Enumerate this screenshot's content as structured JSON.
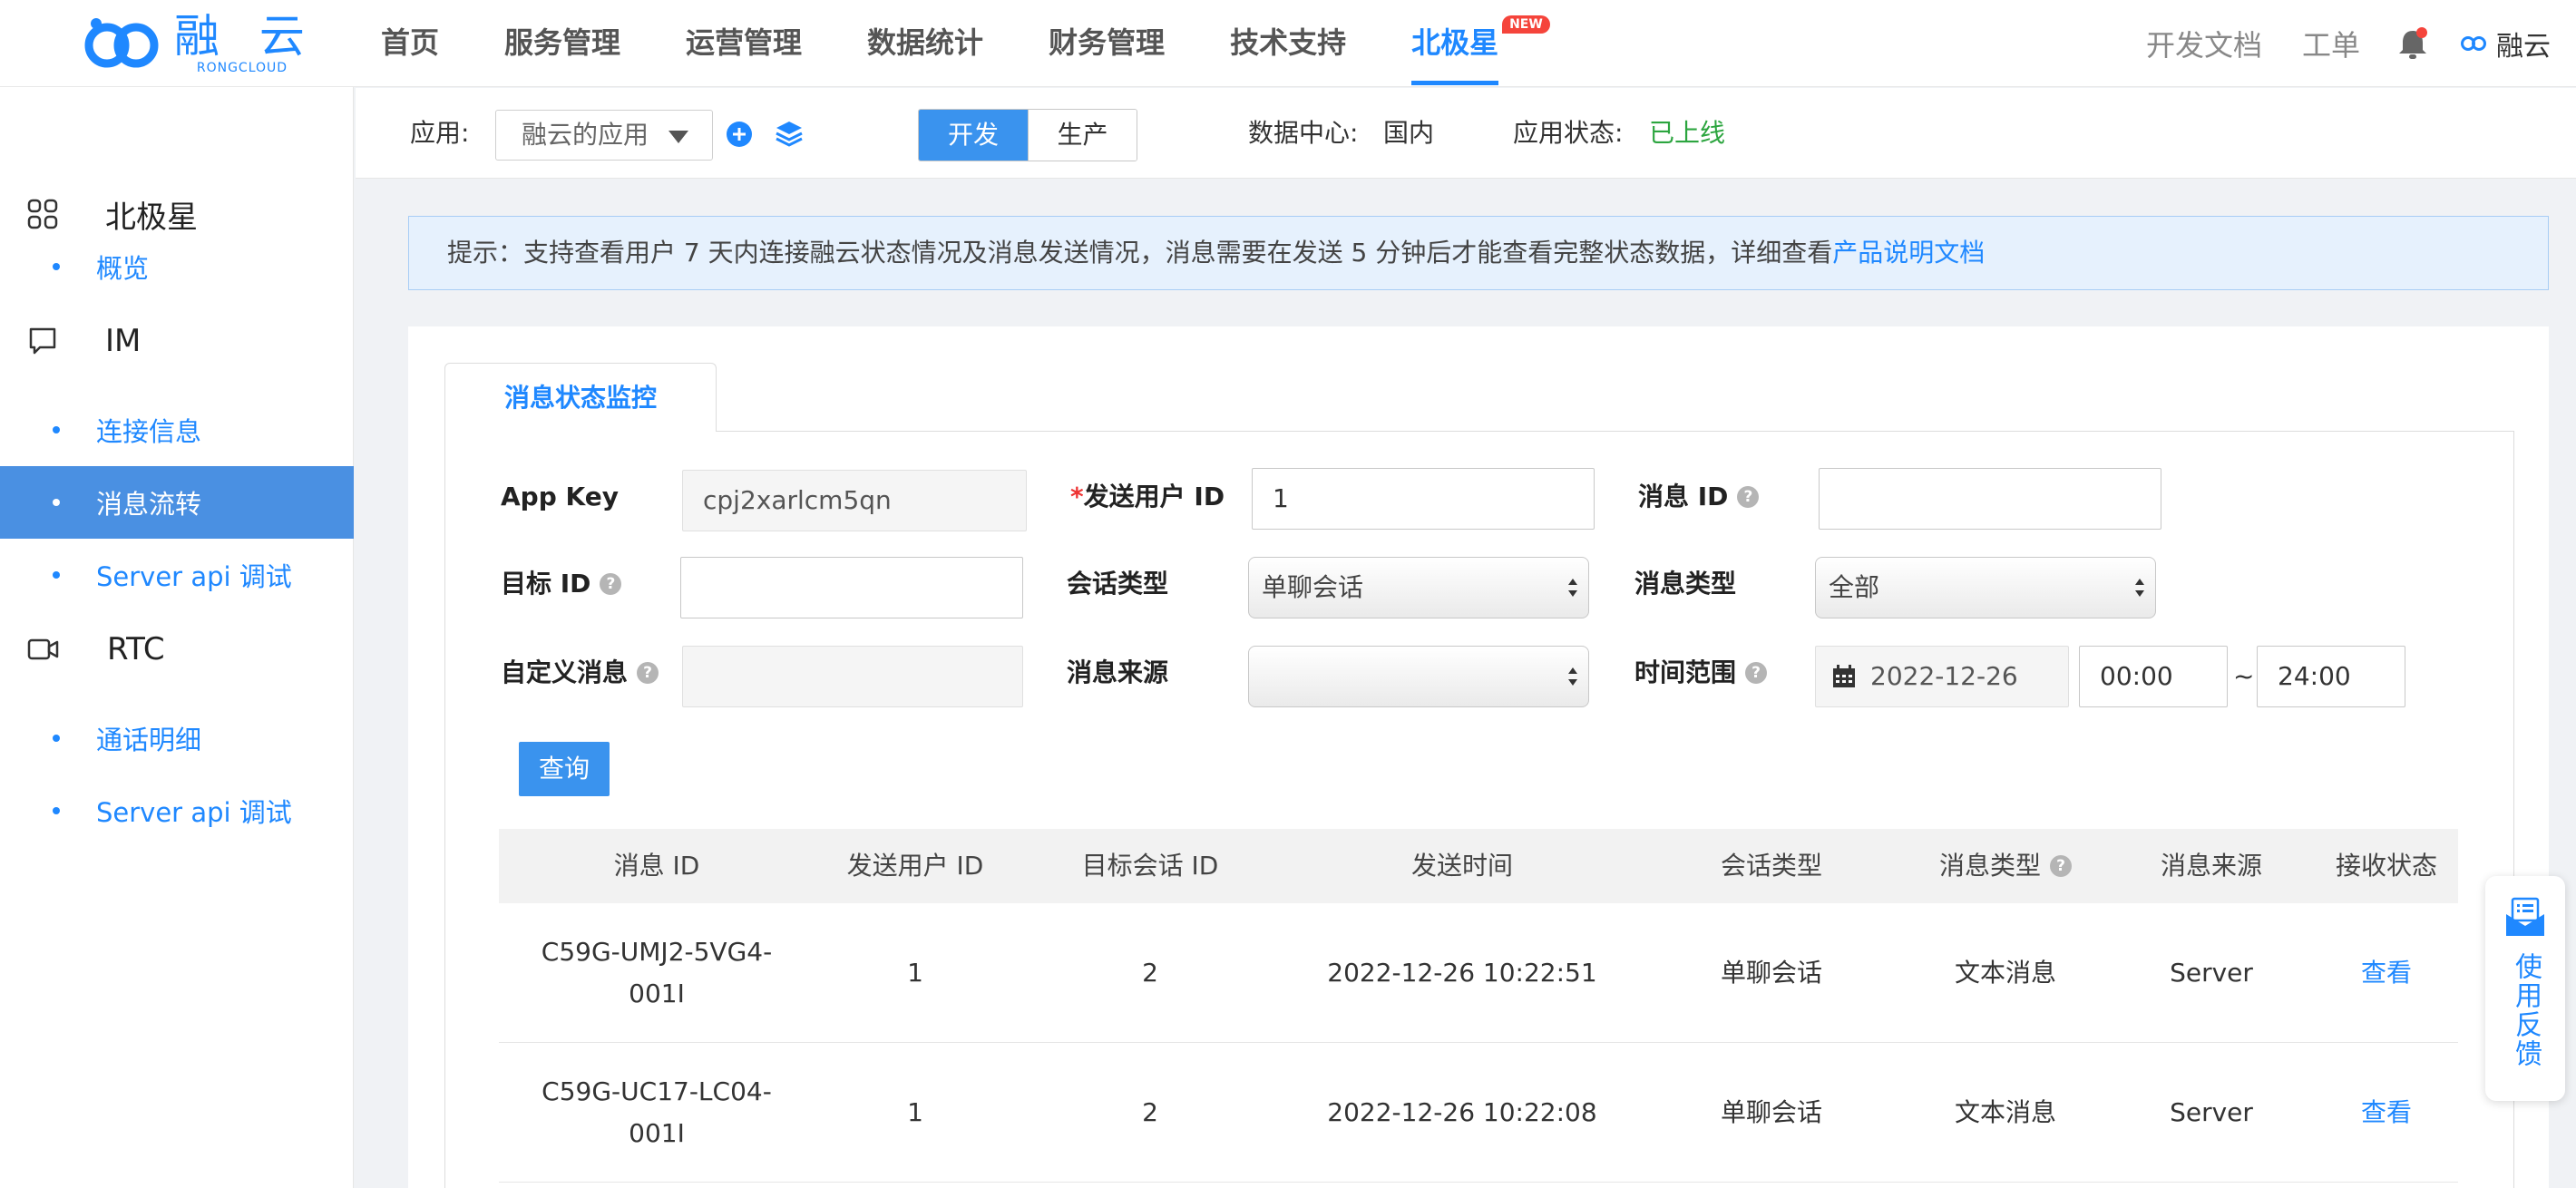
{
  "logo": {
    "cn": "融 云",
    "en": "RONGCLOUD"
  },
  "nav": {
    "items": [
      "首页",
      "服务管理",
      "运营管理",
      "数据统计",
      "财务管理",
      "技术支持",
      "北极星"
    ],
    "new_badge": "NEW",
    "docs": "开发文档",
    "ticket": "工单",
    "user": "融云"
  },
  "sidebar": {
    "groups": [
      {
        "label": "北极星",
        "icon": "grid-icon"
      },
      {
        "label": "IM",
        "icon": "chat-bubble-icon"
      },
      {
        "label": "RTC",
        "icon": "video-camera-icon"
      }
    ],
    "items": [
      "概览",
      "连接信息",
      "消息流转",
      "Server api 调试",
      "通话明细",
      "Server api 调试"
    ]
  },
  "appbar": {
    "app_label": "应用:",
    "app_value": "融云的应用",
    "env_dev": "开发",
    "env_prod": "生产",
    "dc_label": "数据中心:",
    "dc_value": "国内",
    "status_label": "应用状态:",
    "status_value": "已上线",
    "status_color": "#2ca53f"
  },
  "notice": {
    "text": "提示：支持查看用户 7 天内连接融云状态情况及消息发送情况，消息需要在发送 5 分钟后才能查看完整状态数据，详细查看",
    "link": "产品说明文档"
  },
  "tab": "消息状态监控",
  "form": {
    "app_key_label": "App Key",
    "app_key_value": "cpj2xarlcm5qn",
    "sender_label": "发送用户 ID",
    "sender_required": "*",
    "sender_value": "1",
    "msg_id_label": "消息 ID",
    "msg_id_value": "",
    "target_label": "目标 ID",
    "target_value": "",
    "conv_type_label": "会话类型",
    "conv_type_value": "单聊会话",
    "msg_type_label": "消息类型",
    "msg_type_value": "全部",
    "custom_label": "自定义消息",
    "custom_value": "",
    "source_label": "消息来源",
    "source_value": "",
    "time_label": "时间范围",
    "date_value": "2022-12-26",
    "time_start": "00:00",
    "time_sep": "~",
    "time_end": "24:00",
    "query": "查询"
  },
  "table": {
    "headers": [
      "消息 ID",
      "发送用户 ID",
      "目标会话 ID",
      "发送时间",
      "会话类型",
      "消息类型",
      "消息来源",
      "接收状态"
    ],
    "rows": [
      {
        "id_line1": "C59G-UMJ2-5VG4-",
        "id_line2": "001I",
        "sender": "1",
        "target": "2",
        "time": "2022-12-26 10:22:51",
        "conv": "单聊会话",
        "type": "文本消息",
        "source": "Server",
        "status": "查看"
      },
      {
        "id_line1": "C59G-UC17-LC04-",
        "id_line2": "001I",
        "sender": "1",
        "target": "2",
        "time": "2022-12-26 10:22:08",
        "conv": "单聊会话",
        "type": "文本消息",
        "source": "Server",
        "status": "查看"
      }
    ]
  },
  "feedback": "使用反馈",
  "colors": {
    "accent": "#1f88ff",
    "button": "#3a93ee",
    "active_sidebar": "#4a90e2"
  }
}
